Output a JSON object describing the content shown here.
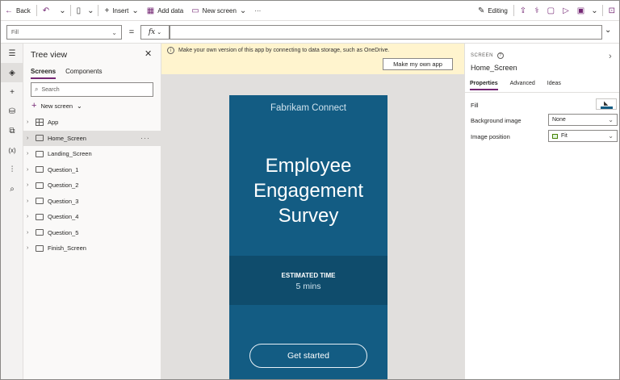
{
  "toolbar": {
    "back": "Back",
    "insert": "Insert",
    "add_data": "Add data",
    "new_screen": "New screen",
    "more": "···",
    "editing": "Editing"
  },
  "formula_bar": {
    "property": "Fill",
    "equals": "=",
    "fx": "fx",
    "value": ""
  },
  "tree_view": {
    "title": "Tree view",
    "tabs": [
      "Screens",
      "Components"
    ],
    "search_placeholder": "Search",
    "new_screen": "New screen",
    "items": [
      {
        "label": "App"
      },
      {
        "label": "Home_Screen",
        "selected": true
      },
      {
        "label": "Landing_Screen"
      },
      {
        "label": "Question_1"
      },
      {
        "label": "Question_2"
      },
      {
        "label": "Question_3"
      },
      {
        "label": "Question_4"
      },
      {
        "label": "Question_5"
      },
      {
        "label": "Finish_Screen"
      }
    ],
    "more_label": "···"
  },
  "banner": {
    "text": "Make your own version of this app by connecting to data storage, such as OneDrive.",
    "button": "Make my own app"
  },
  "app_screen": {
    "brand": "Fabrikam Connect",
    "title_lines": [
      "Employee",
      "Engagement",
      "Survey"
    ],
    "estimated_label": "ESTIMATED TIME",
    "estimated_value": "5 mins",
    "cta": "Get started",
    "colors": {
      "primary": "#135c83",
      "band": "#0f4c6c"
    }
  },
  "properties": {
    "type_label": "SCREEN",
    "name": "Home_Screen",
    "tabs": [
      "Properties",
      "Advanced",
      "Ideas"
    ],
    "rows": {
      "fill": "Fill",
      "background_image": "Background image",
      "background_image_value": "None",
      "image_position": "Image position",
      "image_position_value": "Fit"
    }
  },
  "theme": {
    "accent": "#742774"
  }
}
